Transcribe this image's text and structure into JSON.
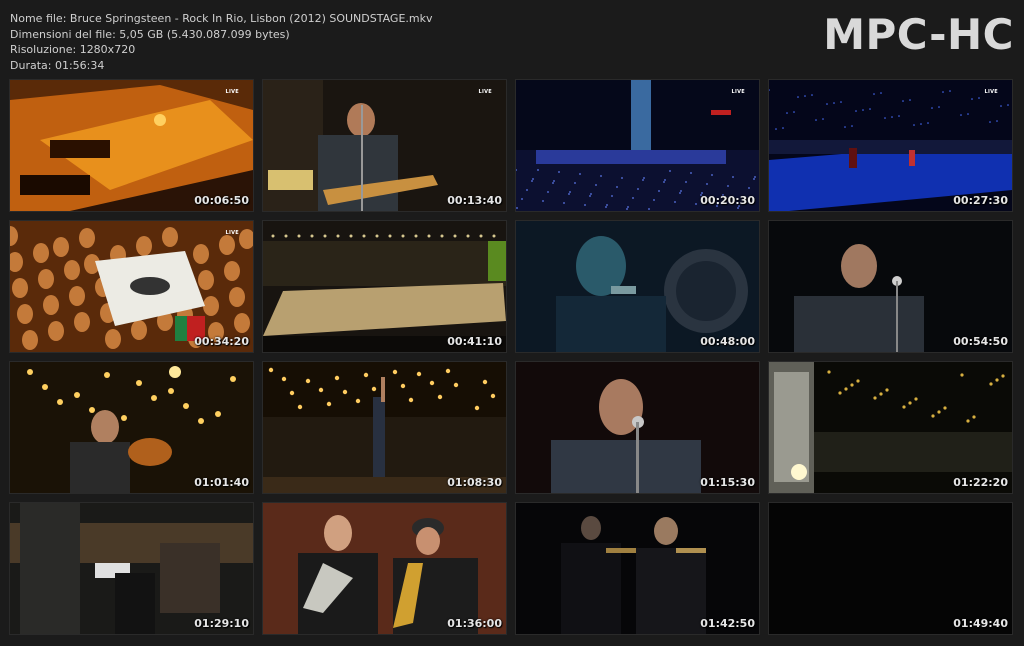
{
  "file_info": {
    "name_line": "Nome file: Bruce Springsteen - Rock In Rio, Lisbon (2012) SOUNDSTAGE.mkv",
    "size_line": "Dimensioni del file: 5,05 GB (5.430.087.099 bytes)",
    "resolution_line": "Risoluzione: 1280x720",
    "duration_line": "Durata: 01:56:34"
  },
  "logo": "MPC-HC",
  "thumbnails": [
    {
      "time": "00:06:50",
      "live": "LIVE",
      "scene": "orange-stage"
    },
    {
      "time": "00:13:40",
      "live": "LIVE",
      "scene": "guitarist-singing"
    },
    {
      "time": "00:20:30",
      "live": "LIVE",
      "scene": "blue-stadium"
    },
    {
      "time": "00:27:30",
      "live": "LIVE",
      "scene": "blue-stage"
    },
    {
      "time": "00:34:20",
      "live": "LIVE",
      "scene": "crowd-shirt"
    },
    {
      "time": "00:41:10",
      "live": "",
      "scene": "wide-stage"
    },
    {
      "time": "00:48:00",
      "live": "",
      "scene": "harmonica-closeup"
    },
    {
      "time": "00:54:50",
      "live": "",
      "scene": "singer-mic-dark"
    },
    {
      "time": "01:01:40",
      "live": "",
      "scene": "guitar-lights"
    },
    {
      "time": "01:08:30",
      "live": "",
      "scene": "arm-raised-stage"
    },
    {
      "time": "01:15:30",
      "live": "",
      "scene": "singer-closeup"
    },
    {
      "time": "01:22:20",
      "live": "",
      "scene": "stage-screens"
    },
    {
      "time": "01:29:10",
      "live": "",
      "scene": "backstage-camera"
    },
    {
      "time": "01:36:00",
      "live": "",
      "scene": "horn-section"
    },
    {
      "time": "01:42:50",
      "live": "",
      "scene": "trumpets-dark"
    },
    {
      "time": "01:49:40",
      "live": "",
      "scene": "black"
    }
  ]
}
